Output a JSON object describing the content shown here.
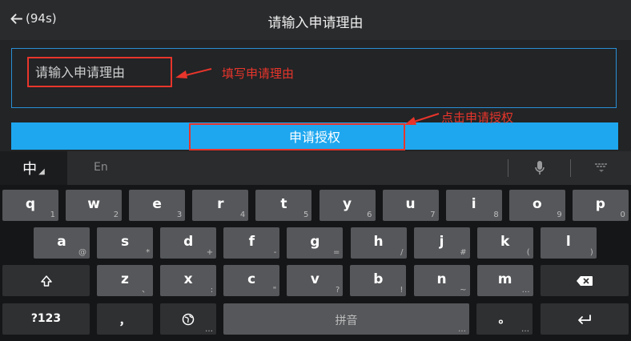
{
  "header": {
    "back_timer": "(94s)",
    "title": "请输入申请理由"
  },
  "form": {
    "reason_placeholder": "请输入申请理由",
    "submit_label": "申请授权"
  },
  "annotations": {
    "fill_reason": "填写申请理由",
    "click_submit": "点击申请授权"
  },
  "colors": {
    "accent": "#1ea7ef",
    "annotation": "#e8352b",
    "border": "#2a8fd6"
  },
  "keyboard": {
    "lang_zh": "中",
    "lang_en": "En",
    "row1": [
      {
        "k": "q",
        "s": "1"
      },
      {
        "k": "w",
        "s": "2"
      },
      {
        "k": "e",
        "s": "3"
      },
      {
        "k": "r",
        "s": "4"
      },
      {
        "k": "t",
        "s": "5"
      },
      {
        "k": "y",
        "s": "6"
      },
      {
        "k": "u",
        "s": "7"
      },
      {
        "k": "i",
        "s": "8"
      },
      {
        "k": "o",
        "s": "9"
      },
      {
        "k": "p",
        "s": "0"
      }
    ],
    "row2": [
      {
        "k": "a",
        "s": "@"
      },
      {
        "k": "s",
        "s": "*"
      },
      {
        "k": "d",
        "s": "+"
      },
      {
        "k": "f",
        "s": "-"
      },
      {
        "k": "g",
        "s": "="
      },
      {
        "k": "h",
        "s": "/"
      },
      {
        "k": "j",
        "s": "#"
      },
      {
        "k": "k",
        "s": "("
      },
      {
        "k": "l",
        "s": ")"
      }
    ],
    "row3": [
      {
        "k": "z",
        "s": "、"
      },
      {
        "k": "x",
        "s": ":"
      },
      {
        "k": "c",
        "s": "\""
      },
      {
        "k": "v",
        "s": "?"
      },
      {
        "k": "b",
        "s": "!"
      },
      {
        "k": "n",
        "s": "~"
      },
      {
        "k": "m",
        "s": "…"
      }
    ],
    "num_key": "?123",
    "comma_key": "，",
    "space_label": "拼音",
    "period_key": "。",
    "icons": [
      "microphone-icon",
      "keyboard-hide-icon",
      "shift-icon",
      "backspace-icon",
      "globe-icon",
      "enter-icon"
    ]
  }
}
